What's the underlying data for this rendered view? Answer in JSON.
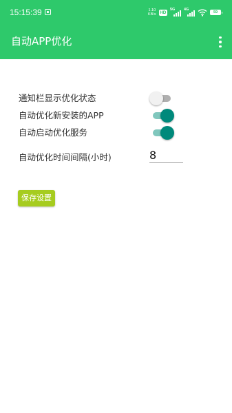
{
  "status_bar": {
    "time": "15:15:39",
    "net_speed_value": "1.10",
    "net_speed_unit": "KB/s",
    "hd_badge": "HD",
    "signal1_label": "5G",
    "signal2_label": "4G",
    "battery_level": "59"
  },
  "app_bar": {
    "title": "自动APP优化",
    "more_icon": "more-vert-icon"
  },
  "settings": {
    "notify_label": "通知栏显示优化状态",
    "notify_enabled": false,
    "auto_new_label": "自动优化新安装的APP",
    "auto_new_enabled": true,
    "auto_start_label": "自动启动优化服务",
    "auto_start_enabled": true,
    "interval_label": "自动优化时间间隔(小时)",
    "interval_value": "8"
  },
  "save_button": {
    "label": "保存设置"
  },
  "colors": {
    "primary": "#2ec96b",
    "switch_on": "#00897b",
    "switch_on_track": "#80c7bd",
    "switch_off_track": "#b0b0b0",
    "save_button": "#a6cc1f"
  }
}
